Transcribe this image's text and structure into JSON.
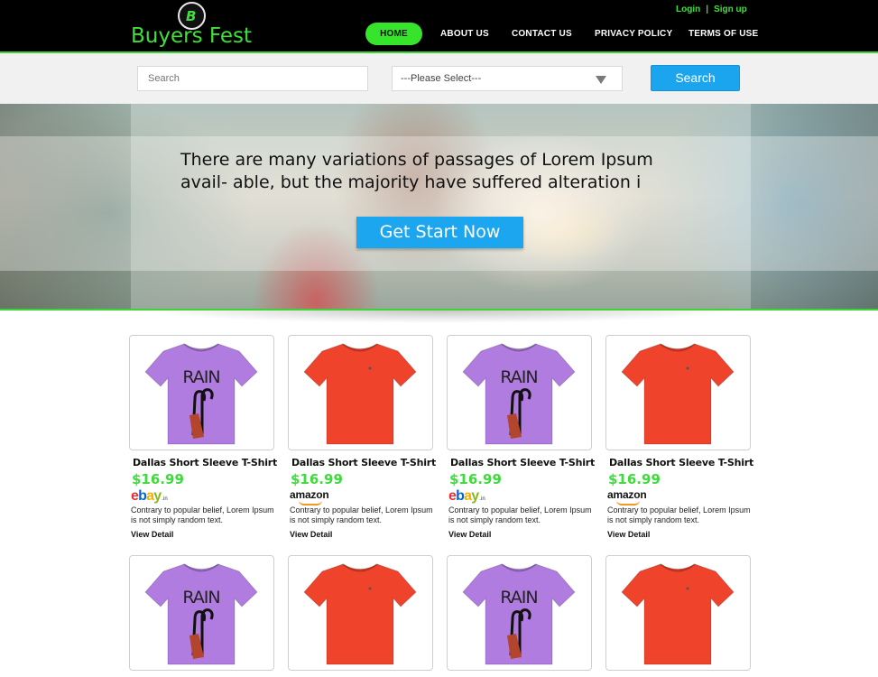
{
  "header": {
    "logo_letter": "B",
    "logo_text": "Buyers Fest",
    "nav": [
      {
        "label": "HOME",
        "active": true
      },
      {
        "label": "ABOUT US",
        "active": false
      },
      {
        "label": "CONTACT US",
        "active": false
      },
      {
        "label": "PRIVACY POLICY",
        "active": false
      },
      {
        "label": "TERMS OF USE",
        "active": false
      }
    ],
    "login": "Login",
    "separator": "|",
    "signup": "Sign up"
  },
  "search": {
    "placeholder": "Search",
    "select_value": "---Please Select---",
    "button": "Search"
  },
  "hero": {
    "text": "There are many variations of passages of Lorem Ipsum avail- able, but the majority have suffered alteration i",
    "button": "Get Start Now"
  },
  "products": [
    {
      "title": "Dallas  Short Sleeve T-Shirt",
      "price": "$16.99",
      "store": "ebay",
      "store_suffix": ".in",
      "desc": "Contrary to popular belief, Lorem Ipsum is not simply random text.",
      "link": "View Detail",
      "shirt": "purple-rain",
      "shirt_text": "RAIN"
    },
    {
      "title": "Dallas  Short Sleeve T-Shirt",
      "price": "$16.99",
      "store": "amazon",
      "desc": "Contrary to popular belief, Lorem Ipsum is not simply random text.",
      "link": "View Detail",
      "shirt": "red-plain"
    },
    {
      "title": "Dallas  Short Sleeve T-Shirt",
      "price": "$16.99",
      "store": "ebay",
      "store_suffix": ".in",
      "desc": "Contrary to popular belief, Lorem Ipsum is not simply random text.",
      "link": "View Detail",
      "shirt": "purple-rain",
      "shirt_text": "RAIN"
    },
    {
      "title": "Dallas  Short Sleeve T-Shirt",
      "price": "$16.99",
      "store": "amazon",
      "desc": "Contrary to popular belief, Lorem Ipsum is not simply random text.",
      "link": "View Detail",
      "shirt": "red-plain"
    },
    {
      "shirt": "purple-rain",
      "shirt_text": "RAIN"
    },
    {
      "shirt": "red-plain"
    },
    {
      "shirt": "purple-rain",
      "shirt_text": "RAIN"
    },
    {
      "shirt": "red-plain"
    }
  ],
  "colors": {
    "accent_green": "#3fe03a",
    "button_blue": "#1aa5ee",
    "shirt_purple": "#b07ce0",
    "shirt_red": "#f0432c"
  }
}
